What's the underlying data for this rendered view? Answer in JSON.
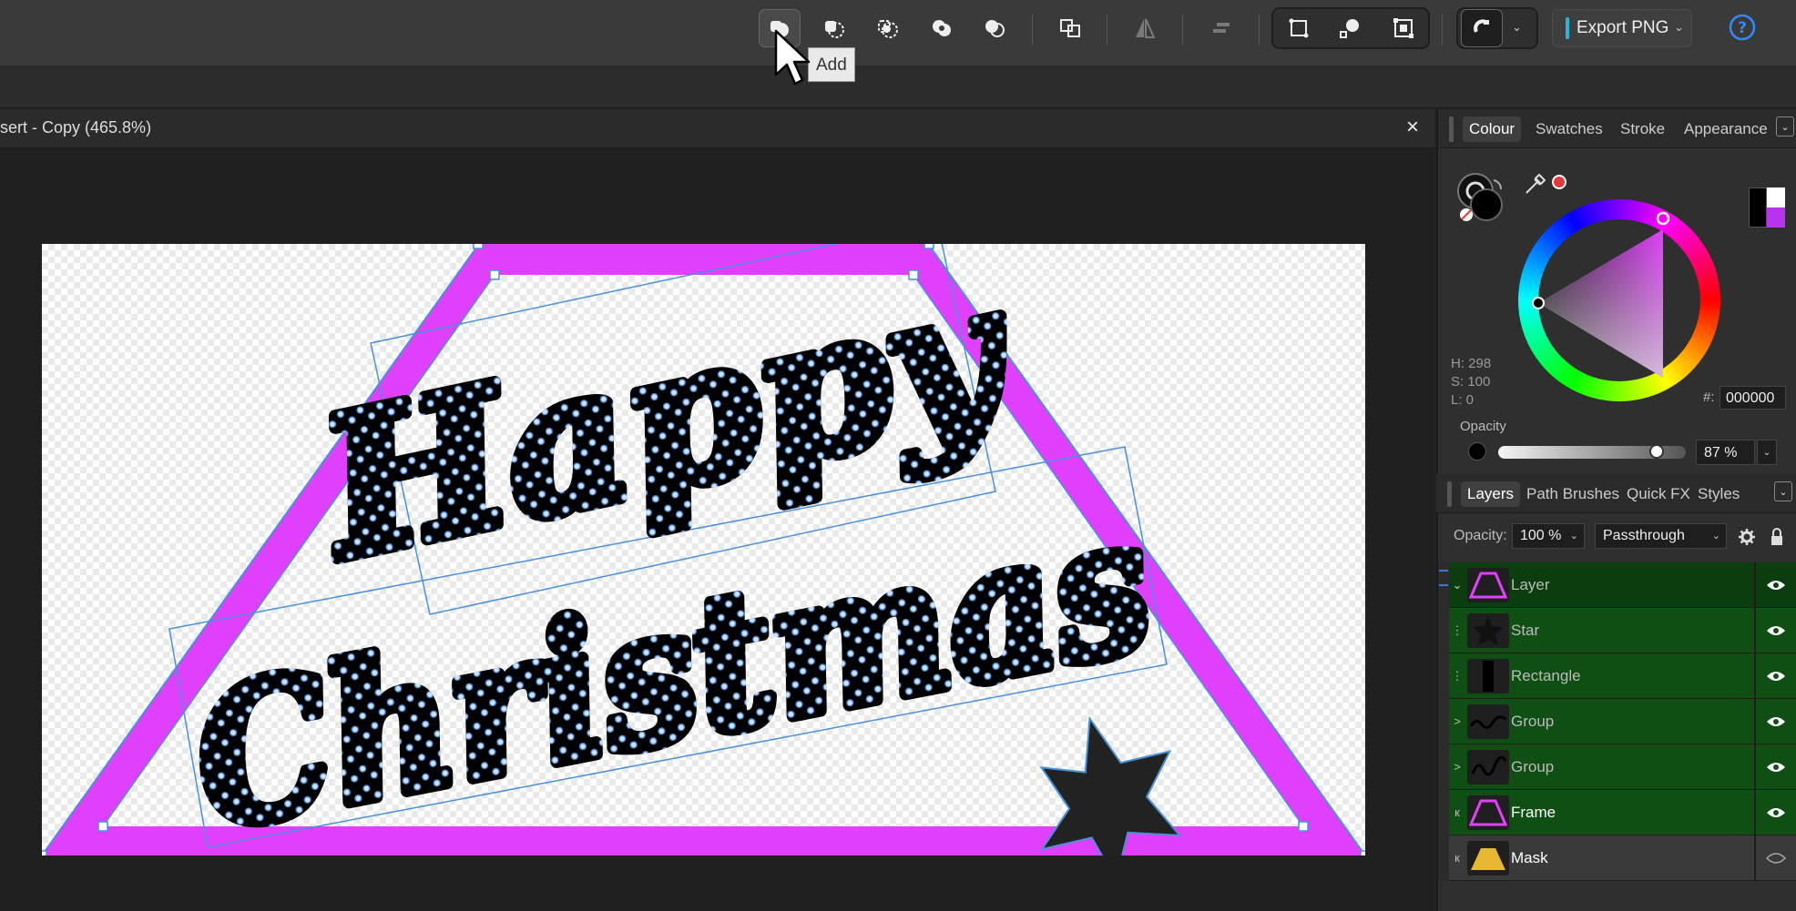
{
  "toolbar": {
    "tooltip": "Add",
    "export_label": "Export PNG"
  },
  "document": {
    "title": "sert - Copy (465.8%)",
    "close_glyph": "×"
  },
  "colour_panel": {
    "tabs": [
      "Colour",
      "Swatches",
      "Stroke",
      "Appearance"
    ],
    "active_tab": "Colour",
    "h": "H: 298",
    "s": "S: 100",
    "l": "L: 0",
    "hex_prefix": "#:",
    "hex_value": "000000",
    "opacity_label": "Opacity",
    "opacity_value": "87 %",
    "opacity_level": 0.87,
    "fill_color": "#000000",
    "accent_color": "#e040fb"
  },
  "layers_panel": {
    "tabs": [
      "Layers",
      "Path Brushes",
      "Quick FX",
      "Styles"
    ],
    "active_tab": "Layers",
    "opacity_label": "Opacity:",
    "opacity_value": "100 %",
    "blend_mode": "Passthrough",
    "layers": [
      {
        "name": "Layer",
        "icon": "layer-thumb"
      },
      {
        "name": "Star",
        "icon": "star-thumb"
      },
      {
        "name": "Rectangle",
        "icon": "rectangle-thumb"
      },
      {
        "name": "Group",
        "icon": "christmas-thumb"
      },
      {
        "name": "Group",
        "icon": "happy-thumb"
      },
      {
        "name": "Frame",
        "icon": "frame-thumb"
      },
      {
        "name": "Mask",
        "icon": "mask-thumb"
      }
    ]
  },
  "artwork": {
    "line1": "Happy",
    "line2": "Christmas",
    "frame_color": "#e040fb",
    "selection_color": "#4a90d9"
  }
}
